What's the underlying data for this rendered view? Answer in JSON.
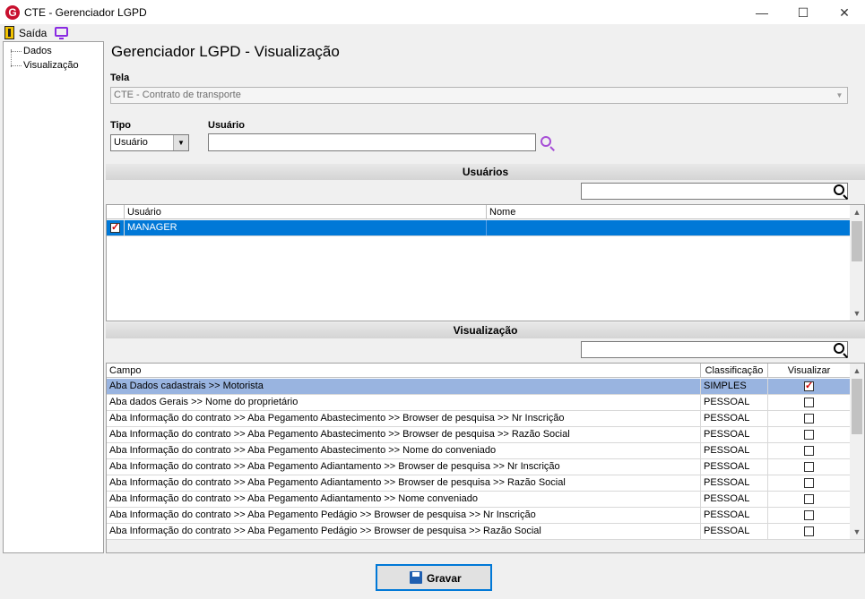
{
  "window": {
    "title": "CTE - Gerenciador LGPD",
    "logo_letter": "G",
    "minimize_glyph": "—",
    "maximize_glyph": "☐",
    "close_glyph": "✕"
  },
  "menu": {
    "exit_label": "Saída"
  },
  "sidebar": {
    "items": [
      {
        "label": "Dados"
      },
      {
        "label": "Visualização"
      }
    ]
  },
  "main": {
    "title": "Gerenciador LGPD - Visualização",
    "tela_label": "Tela",
    "tela_value": "CTE - Contrato de transporte",
    "tipo_label": "Tipo",
    "tipo_value": "Usuário",
    "usuario_label": "Usuário",
    "usuario_value": ""
  },
  "users_section": {
    "title": "Usuários",
    "search_value": "",
    "columns": [
      "Usuário",
      "Nome"
    ],
    "rows": [
      {
        "checked": true,
        "usuario": "MANAGER",
        "nome": ""
      }
    ]
  },
  "view_section": {
    "title": "Visualização",
    "search_value": "",
    "columns": [
      "Campo",
      "Classificação",
      "Visualizar"
    ],
    "rows": [
      {
        "campo": "Aba Dados cadastrais >> Motorista",
        "classificacao": "SIMPLES",
        "visualizar": true
      },
      {
        "campo": "Aba dados Gerais >> Nome do proprietário",
        "classificacao": "PESSOAL",
        "visualizar": false
      },
      {
        "campo": "Aba Informação do contrato >> Aba Pegamento Abastecimento >> Browser de pesquisa >> Nr Inscrição",
        "classificacao": "PESSOAL",
        "visualizar": false
      },
      {
        "campo": "Aba Informação do contrato >> Aba Pegamento Abastecimento >> Browser de pesquisa >> Razão Social",
        "classificacao": "PESSOAL",
        "visualizar": false
      },
      {
        "campo": "Aba Informação do contrato >> Aba Pegamento Abastecimento >> Nome do conveniado",
        "classificacao": "PESSOAL",
        "visualizar": false
      },
      {
        "campo": "Aba Informação do contrato >> Aba Pegamento Adiantamento >> Browser de pesquisa >> Nr Inscrição",
        "classificacao": "PESSOAL",
        "visualizar": false
      },
      {
        "campo": "Aba Informação do contrato >> Aba Pegamento Adiantamento >> Browser de pesquisa >> Razão Social",
        "classificacao": "PESSOAL",
        "visualizar": false
      },
      {
        "campo": "Aba Informação do contrato >> Aba Pegamento Adiantamento >> Nome conveniado",
        "classificacao": "PESSOAL",
        "visualizar": false
      },
      {
        "campo": "Aba Informação do contrato >> Aba Pegamento Pedágio >> Browser de pesquisa >> Nr Inscrição",
        "classificacao": "PESSOAL",
        "visualizar": false
      },
      {
        "campo": "Aba Informação do contrato >> Aba Pegamento Pedágio >> Browser de pesquisa >> Razão Social",
        "classificacao": "PESSOAL",
        "visualizar": false
      }
    ]
  },
  "footer": {
    "save_label": "Gravar"
  },
  "colors": {
    "selection": "#0078d7",
    "row_highlight": "#99b4e0",
    "check_mark": "#d10000",
    "logo": "#c8102e",
    "search_purple": "#a64ed6"
  },
  "icons": [
    "app-logo-icon",
    "exit-door-icon",
    "monitor-icon",
    "search-icon",
    "save-disk-icon",
    "chevron-down-icon"
  ]
}
